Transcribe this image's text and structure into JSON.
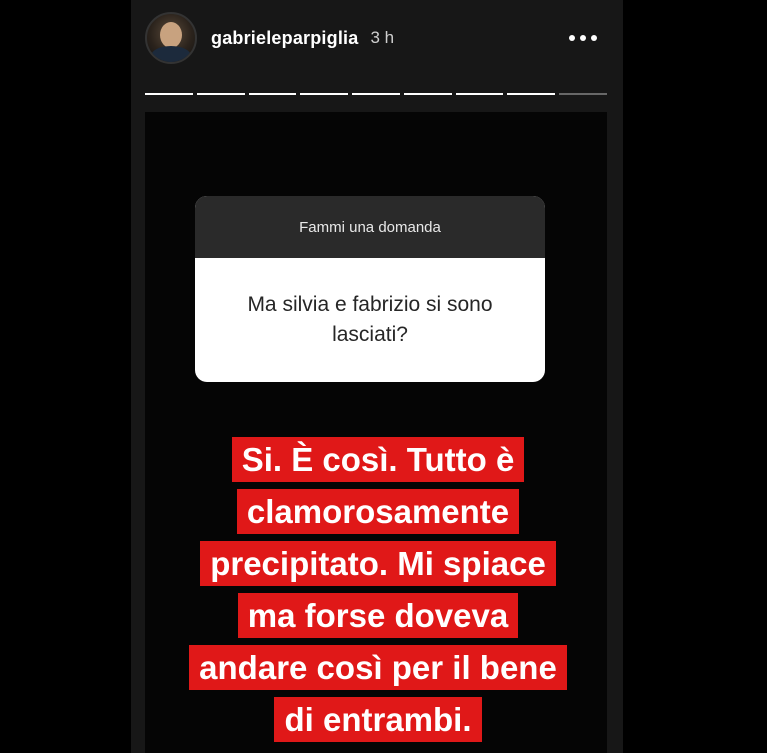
{
  "story": {
    "username": "gabrieleparpiglia",
    "time": "3 h",
    "progress": {
      "total_segments": 9,
      "completed_segments": 8
    },
    "colors": {
      "background": "#000000",
      "answer_highlight": "#e01818",
      "question_header_bg": "#2a2a2a",
      "question_body_bg": "#ffffff"
    }
  },
  "question_sticker": {
    "header": "Fammi una domanda",
    "question": "Ma silvia e fabrizio si sono lasciati?"
  },
  "answer": {
    "lines": [
      "Si. È così. Tutto è",
      "clamorosamente",
      "precipitato. Mi spiace",
      "ma forse doveva",
      "andare così per il bene",
      "di entrambi."
    ]
  },
  "icons": {
    "more": "more-horizontal-icon",
    "avatar": "profile-avatar"
  }
}
